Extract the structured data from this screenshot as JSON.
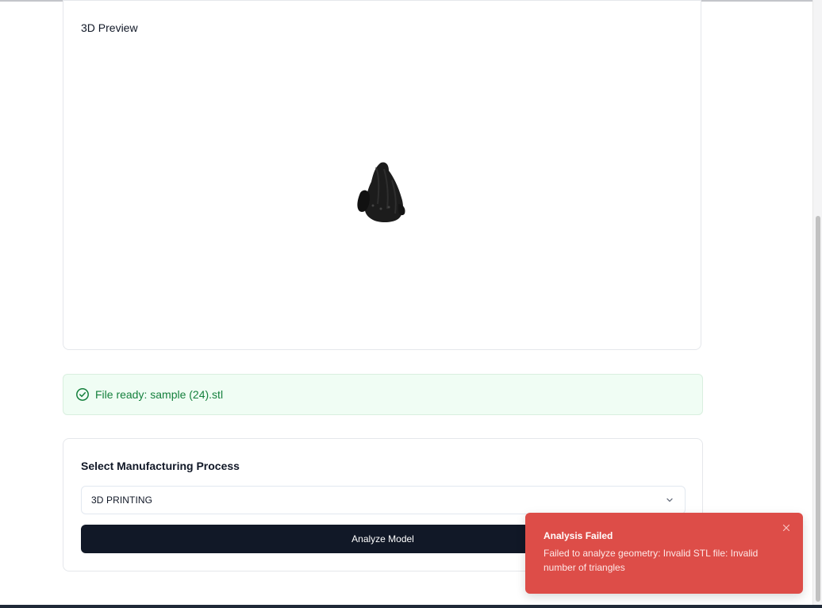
{
  "preview": {
    "title": "3D Preview"
  },
  "status": {
    "message": "File ready: sample (24).stl",
    "icon": "check-circle-icon",
    "color": "#15803d"
  },
  "process": {
    "title": "Select Manufacturing Process",
    "selected": "3D PRINTING",
    "analyze_label": "Analyze Model"
  },
  "toast": {
    "title": "Analysis Failed",
    "message": "Failed to analyze geometry: Invalid STL file: Invalid number of triangles",
    "background": "#dd4d48"
  }
}
